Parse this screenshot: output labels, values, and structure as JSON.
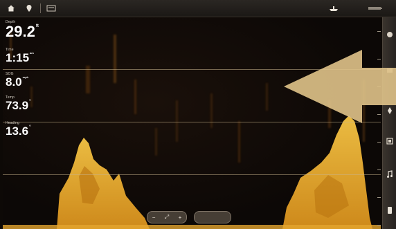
{
  "topbar": {
    "icons": [
      "home-icon",
      "pin-icon",
      "menu-icon",
      "boat-icon",
      "battery-icon"
    ]
  },
  "readouts": {
    "depth": {
      "label": "Depth",
      "value": "29.2",
      "unit": "ft"
    },
    "time": {
      "label": "Time",
      "value": "1:15",
      "unit": "am"
    },
    "speed": {
      "label": "SOG",
      "value": "8.0",
      "unit": "mph"
    },
    "temp": {
      "label": "Temp",
      "value": "73.9",
      "unit": "°"
    },
    "heading": {
      "label": "Heading",
      "value": "13.6",
      "unit": "°"
    }
  },
  "bottom_controls": {
    "zoom_out": "−",
    "zoom_mid": "⤢",
    "zoom_in": "+"
  },
  "colors": {
    "sonar_return": "#f0b43a",
    "arrow": "#e0c389",
    "background": "#0d0906"
  }
}
